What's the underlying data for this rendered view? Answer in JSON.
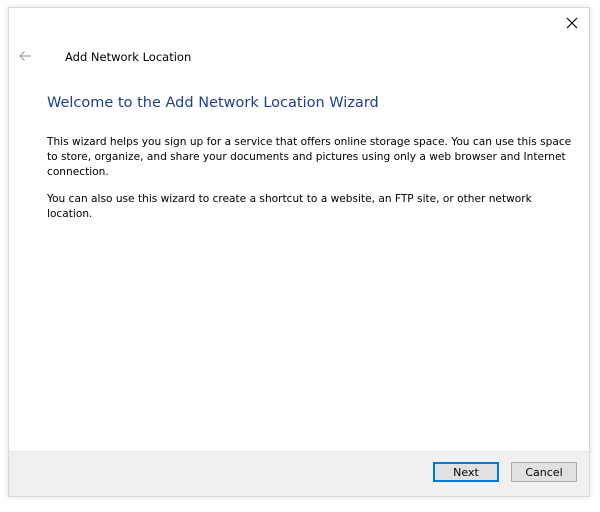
{
  "window": {
    "title": "Add Network Location",
    "back_icon": "arrow-left-icon",
    "close_icon": "close-x-icon"
  },
  "content": {
    "heading": "Welcome to the Add Network Location Wizard",
    "paragraph1": "This wizard helps you sign up for a service that offers online storage space.  You can use this space to store, organize, and share your documents and pictures using only a web browser and Internet connection.",
    "paragraph2": "You can also use this wizard to create a shortcut to a website, an FTP site, or other network location."
  },
  "footer": {
    "next_label": "Next",
    "cancel_label": "Cancel"
  },
  "colors": {
    "heading": "#1e3f87",
    "default_button_border": "#0078d7",
    "footer_bg": "#f0f0f0"
  }
}
